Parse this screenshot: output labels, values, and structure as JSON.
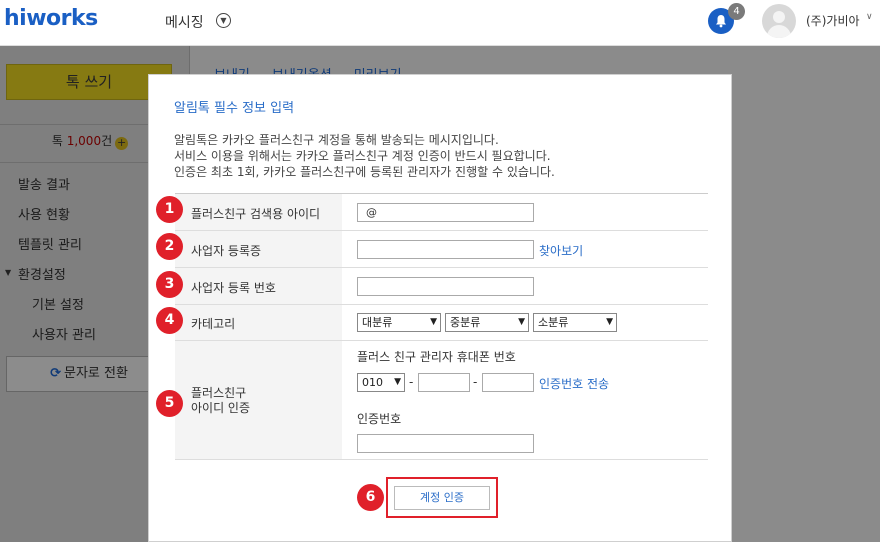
{
  "header": {
    "logo": "hiworks",
    "app_name": "메시징",
    "notification_count": "4",
    "company": "(주)가비아"
  },
  "sidebar": {
    "compose_label": "톡 쓰기",
    "credit_prefix": "톡 ",
    "credit_count": "1,000",
    "credit_suffix": "건",
    "items": [
      {
        "label": "발송 결과"
      },
      {
        "label": "사용 현황"
      },
      {
        "label": "템플릿 관리"
      },
      {
        "label": "환경설정"
      },
      {
        "label": "기본 설정"
      },
      {
        "label": "사용자 관리"
      }
    ],
    "switch_label": "문자로 전환"
  },
  "content": {
    "tabs": [
      "보내기",
      "보내기옵션",
      "미리보기"
    ]
  },
  "modal": {
    "title": "알림톡 필수 정보 입력",
    "desc": [
      "알림톡은 카카오 플러스친구 계정을 통해 발송되는 메시지입니다.",
      "서비스 이용을 위해서는 카카오 플러스친구 계정 인증이 반드시 필요합니다.",
      "인증은 최초 1회, 카카오 플러스친구에 등록된 관리자가 진행할 수 있습니다."
    ],
    "rows": {
      "search_id": {
        "num": "1",
        "label": "플러스친구 검색용 아이디",
        "value": "@"
      },
      "license": {
        "num": "2",
        "label": "사업자 등록증",
        "value": "",
        "link": "찾아보기"
      },
      "biz_no": {
        "num": "3",
        "label": "사업자 등록 번호",
        "value": ""
      },
      "category": {
        "num": "4",
        "label": "카테고리",
        "options": [
          "대분류",
          "중분류",
          "소분류"
        ]
      },
      "verify": {
        "num": "5",
        "label_line1": "플러스친구",
        "label_line2": "아이디 인증",
        "phone_label": "플러스 친구 관리자 휴대폰 번호",
        "phone_prefix": "010",
        "dash": "-",
        "send_code": "인증번호 전송",
        "code_label": "인증번호"
      }
    },
    "submit": {
      "num": "6",
      "label": "계정 인증"
    }
  }
}
